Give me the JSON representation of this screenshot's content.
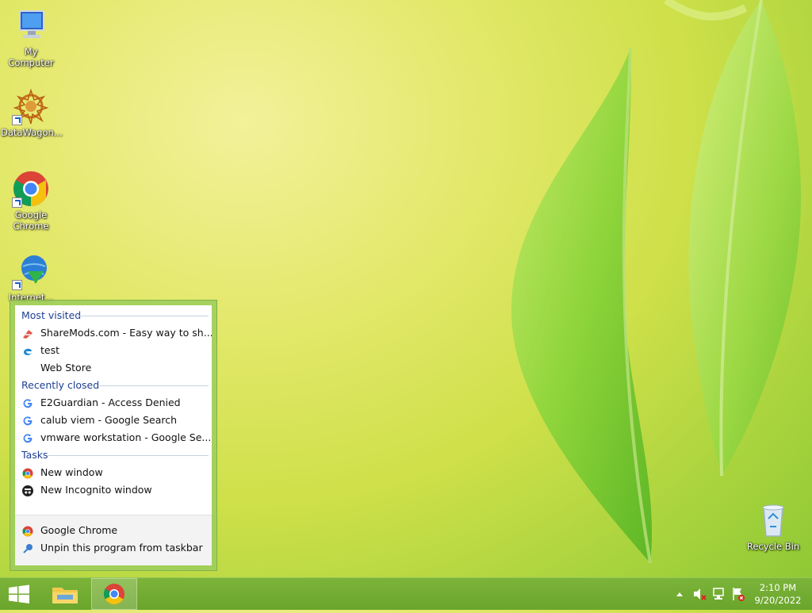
{
  "desktop": {
    "icons": [
      {
        "label": "My Computer"
      },
      {
        "label": "DataWagon..."
      },
      {
        "label": "Google Chrome"
      },
      {
        "label": "Internet..."
      },
      {
        "label": "Recycle Bin"
      }
    ]
  },
  "jumplist": {
    "most_visited_header": "Most visited",
    "most_visited": [
      {
        "label": "ShareMods.com - Easy way to sh...",
        "icon": "sharemods-icon"
      },
      {
        "label": "test",
        "icon": "edge-icon"
      },
      {
        "label": "Web Store",
        "icon": ""
      }
    ],
    "recently_closed_header": "Recently closed",
    "recently_closed": [
      {
        "label": "E2Guardian - Access Denied",
        "icon": "google-icon"
      },
      {
        "label": "calub viem - Google Search",
        "icon": "google-icon"
      },
      {
        "label": "vmware workstation - Google Se...",
        "icon": "google-icon"
      }
    ],
    "tasks_header": "Tasks",
    "tasks": [
      {
        "label": "New window",
        "icon": "chrome-icon"
      },
      {
        "label": "New Incognito window",
        "icon": "incognito-icon"
      }
    ],
    "bottom": [
      {
        "label": "Google Chrome",
        "icon": "chrome-icon"
      },
      {
        "label": "Unpin this program from taskbar",
        "icon": "unpin-icon"
      }
    ]
  },
  "taskbar": {
    "clock_time": "2:10 PM",
    "clock_date": "9/20/2022"
  },
  "colors": {
    "taskbar": "#6ea92f",
    "section_header": "#1e3f91",
    "chrome_red": "#db4437",
    "chrome_yellow": "#f4c20d",
    "chrome_green": "#0f9d58",
    "chrome_blue": "#4285f4"
  }
}
